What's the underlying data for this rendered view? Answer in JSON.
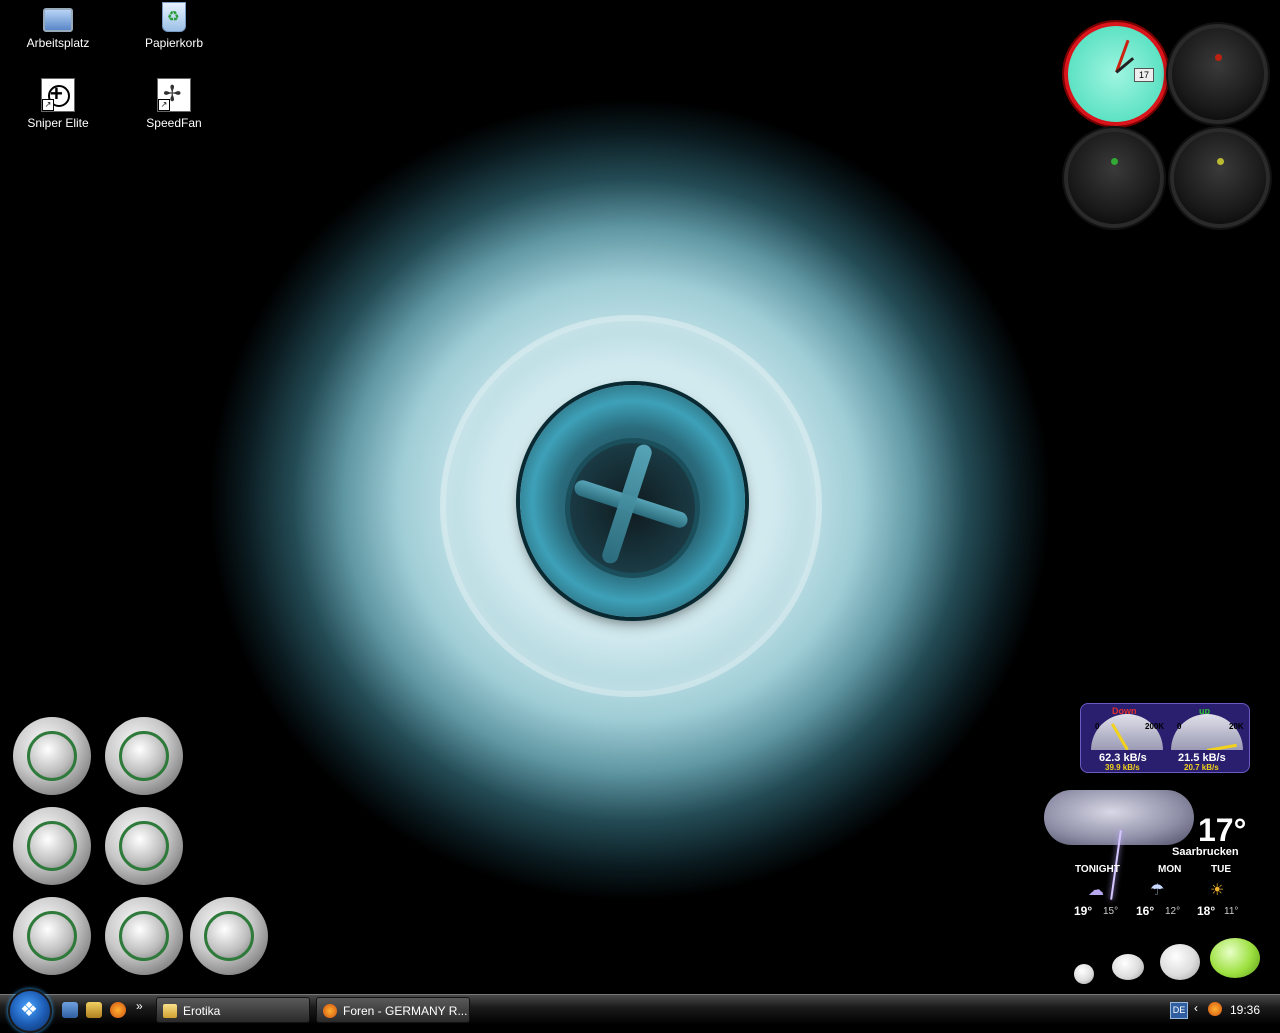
{
  "desktop_icons": [
    {
      "label": "Arbeitsplatz",
      "icon": "my-computer-icon"
    },
    {
      "label": "Papierkorb",
      "icon": "recycle-bin-icon"
    },
    {
      "label": "Sniper Elite",
      "icon": "sniper-elite-icon"
    },
    {
      "label": "SpeedFan",
      "icon": "speedfan-icon"
    }
  ],
  "clock": {
    "date_badge": "17"
  },
  "netmeter": {
    "down": {
      "title": "Down",
      "scale_min": "0",
      "scale_max": "200K",
      "current": "62.3 kB/s",
      "average": "39.9 kB/s",
      "level": 0.31
    },
    "up": {
      "title": "up",
      "scale_min": "0",
      "scale_max": "20K",
      "current": "21.5 kB/s",
      "average": "20.7 kB/s",
      "level": 1.0
    }
  },
  "weather": {
    "temperature": "17°",
    "city": "Saarbrucken",
    "forecast": [
      {
        "day": "TONIGHT",
        "high": "19°",
        "low": "15°"
      },
      {
        "day": "MON",
        "high": "16°",
        "low": "12°"
      },
      {
        "day": "TUE",
        "high": "18°",
        "low": "11°"
      }
    ]
  },
  "taskbar": {
    "quick_launch_more": "»",
    "windows": [
      {
        "label": "Erotika",
        "icon": "folder-icon"
      },
      {
        "label": "Foren - GERMANY R...",
        "icon": "firefox-icon"
      }
    ],
    "tray": {
      "language": "DE",
      "time": "19:36"
    }
  },
  "colors": {
    "clock_face": "#5ee2c4",
    "clock_rim": "#d9141a",
    "netmeter_bg": "#2a1e6e",
    "button_ring": "#2e7a3a"
  }
}
